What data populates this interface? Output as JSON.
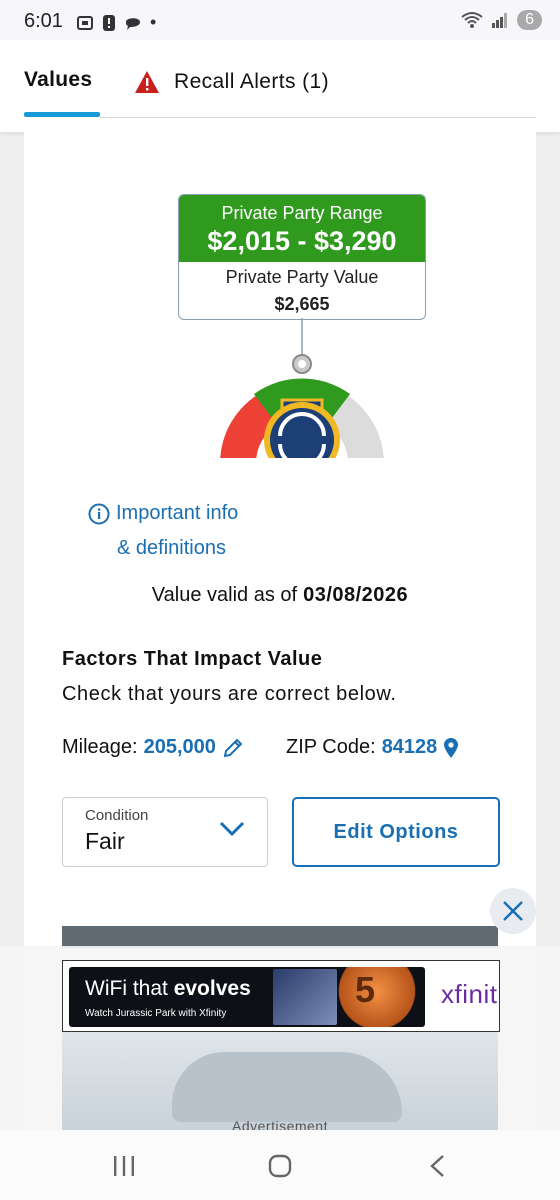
{
  "status_bar": {
    "time": "6:01",
    "battery_level": "6"
  },
  "tabs": {
    "values_label": "Values",
    "recall_label": "Recall Alerts (1)"
  },
  "valuation": {
    "range_label": "Private Party Range",
    "range_value": "$2,015 - $3,290",
    "value_label": "Private Party Value",
    "value": "$2,665"
  },
  "info": {
    "link_line1": "Important info",
    "link_line2": "& definitions"
  },
  "validity": {
    "prefix": "Value valid as of",
    "date": "03/08/2026"
  },
  "factors": {
    "title": "Factors That Impact Value",
    "subtitle": "Check that yours are correct below.",
    "mileage_label": "Mileage:",
    "mileage_value": "205,000",
    "zip_label": "ZIP Code:",
    "zip_value": "84128"
  },
  "condition": {
    "label": "Condition",
    "value": "Fair"
  },
  "edit_options_label": "Edit Options",
  "ad": {
    "headline_plain": "WiFi that ",
    "headline_bold": "evolves",
    "sub": "Watch Jurassic Park with Xfinity",
    "badge_number": "5",
    "brand": "xfinit",
    "label": "Advertisement"
  },
  "colors": {
    "accent_blue": "#1a6fb3",
    "tab_underline": "#1a9ad6",
    "range_green": "#2f9a1e",
    "gauge_red": "#ee4136",
    "gauge_green": "#2f9a1e",
    "gauge_gray": "#dcdcdc",
    "ribbon_navy": "#1d3f78",
    "ribbon_gold": "#f2b824"
  },
  "icons": [
    "wifi-icon",
    "signal-icon",
    "warning-icon",
    "info-icon",
    "pencil-icon",
    "location-pin-icon",
    "chevron-down-icon",
    "close-icon",
    "award-ribbon-icon"
  ]
}
